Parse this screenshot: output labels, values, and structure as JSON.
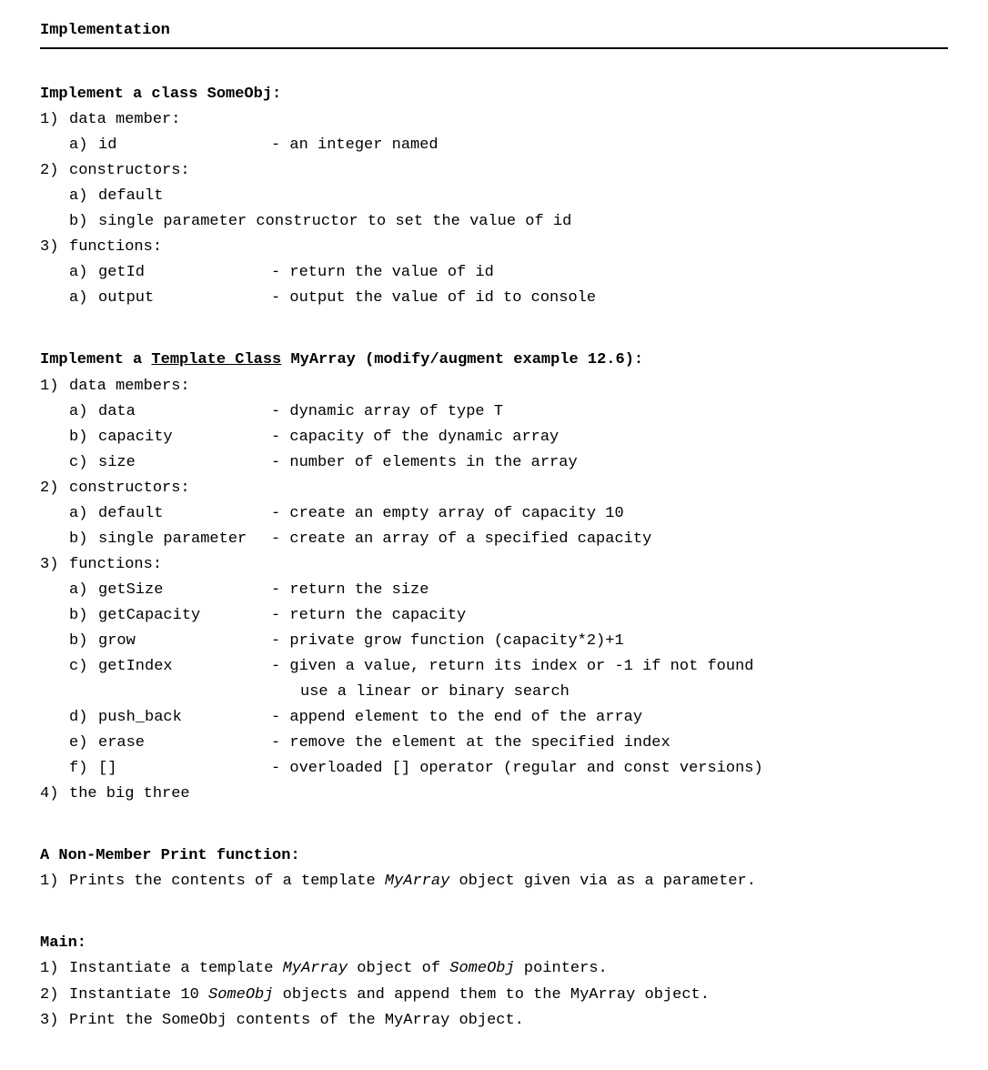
{
  "title": "Implementation",
  "section1": {
    "header": "Implement a class SomeObj:",
    "items": [
      {
        "num": "1)",
        "text": "data member:"
      },
      {
        "sub": "a)",
        "name": "id",
        "desc": "- an integer named"
      },
      {
        "num": "2)",
        "text": "constructors:"
      },
      {
        "sub": "a)",
        "name": "default"
      },
      {
        "sub": "b)",
        "text": "single parameter constructor to set the value of id"
      },
      {
        "num": "3)",
        "text": "functions:"
      },
      {
        "sub": "a)",
        "name": "getId",
        "desc": "- return the value of id"
      },
      {
        "sub": "a)",
        "name": "output",
        "desc": "- output the value of id to console"
      }
    ]
  },
  "section2": {
    "header_prefix": "Implement a ",
    "header_underline": "Template Class",
    "header_suffix": " MyArray (modify/augment example 12.6):",
    "items": [
      {
        "num": "1)",
        "text": "data members:"
      },
      {
        "sub": "a)",
        "name": "data",
        "desc": "- dynamic array of type T"
      },
      {
        "sub": "b)",
        "name": "capacity",
        "desc": "- capacity of the dynamic array"
      },
      {
        "sub": "c)",
        "name": "size",
        "desc": "- number of elements in the array"
      },
      {
        "num": "2)",
        "text": "constructors:"
      },
      {
        "sub": "a)",
        "name": "default",
        "desc": "- create an empty array of capacity 10"
      },
      {
        "sub": "b)",
        "name": "single parameter",
        "desc": "- create an array of a specified capacity"
      },
      {
        "num": "3)",
        "text": "functions:"
      },
      {
        "sub": "a)",
        "name": "getSize",
        "desc": "- return the size"
      },
      {
        "sub": "b)",
        "name": "getCapacity",
        "desc": "- return the capacity"
      },
      {
        "sub": "b)",
        "name": "grow",
        "desc": "- private grow function (capacity*2)+1"
      },
      {
        "sub": "c)",
        "name": "getIndex",
        "desc": "- given a value, return its index or -1 if not found"
      },
      {
        "cont": "use a linear or binary search"
      },
      {
        "sub": "d)",
        "name": "push_back",
        "desc": "- append element to the end of the array"
      },
      {
        "sub": "e)",
        "name": "erase",
        "desc": "- remove the element at the specified index"
      },
      {
        "sub": "f)",
        "name": "[]",
        "desc": "- overloaded [] operator (regular and const versions)"
      },
      {
        "num": "4)",
        "text": "the big three"
      }
    ]
  },
  "section3": {
    "header": "A Non-Member Print function:",
    "line_num": "1)",
    "line_pre": "Prints the contents of a template ",
    "line_italic": "MyArray",
    "line_post": " object given via as a parameter."
  },
  "section4": {
    "header": "Main:",
    "l1_num": "1)",
    "l1_pre": "Instantiate a template ",
    "l1_i1": "MyArray",
    "l1_mid": " object of ",
    "l1_i2": "SomeObj",
    "l1_post": " pointers.",
    "l2_num": "2)",
    "l2_pre": "Instantiate 10 ",
    "l2_i1": "SomeObj",
    "l2_post": " objects and append them to the MyArray object.",
    "l3_num": "3)",
    "l3_text": "Print the SomeObj contents of the MyArray object."
  }
}
